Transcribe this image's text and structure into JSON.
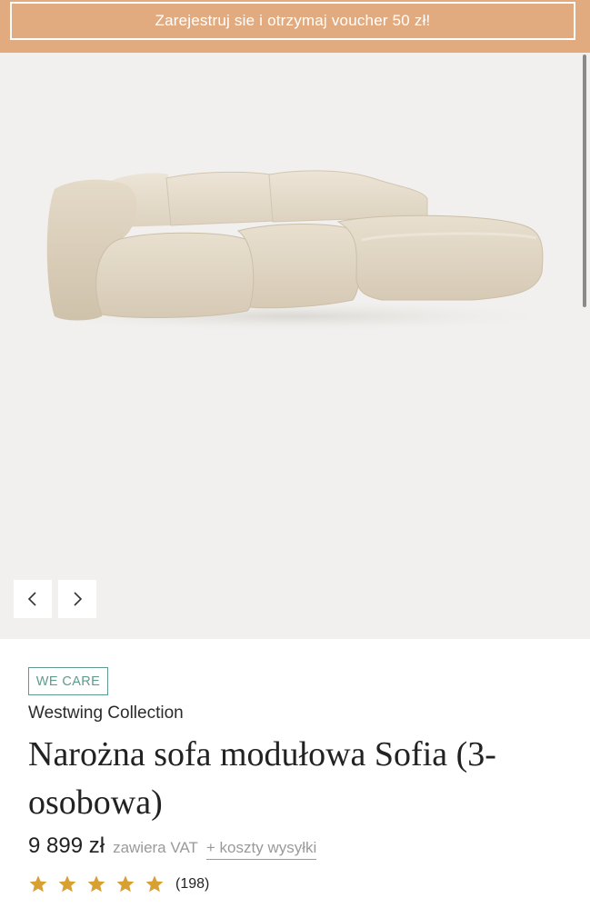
{
  "promo": {
    "text": "Zarejestruj sie i otrzymaj voucher 50 zł!"
  },
  "gallery": {
    "prev_icon": "chevron-left-icon",
    "next_icon": "chevron-right-icon"
  },
  "product": {
    "badge": "WE CARE",
    "brand": "Westwing Collection",
    "title": "Narożna sofa modułowa Sofia (3-osobowa)",
    "price": "9 899 zł",
    "vat_note": "zawiera VAT",
    "shipping_link": "+ koszty wysyłki",
    "rating": {
      "stars": 5,
      "count": "(198)"
    }
  },
  "colors": {
    "promo_bg": "#e2ab7f",
    "badge_accent": "#5f9b8e",
    "star": "#d8a033",
    "gallery_bg": "#f1f0ee"
  }
}
